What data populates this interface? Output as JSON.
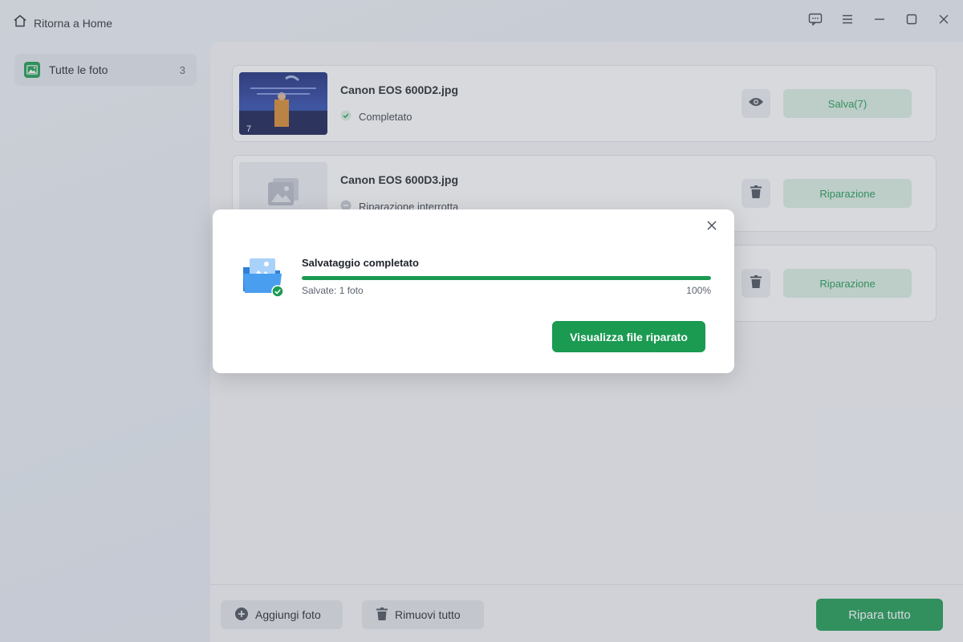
{
  "titlebar": {
    "home_label": "Ritorna a Home"
  },
  "sidebar": {
    "items": [
      {
        "label": "Tutte le foto",
        "count": "3"
      }
    ]
  },
  "files": [
    {
      "name": "Canon EOS 600D2.jpg",
      "status": "Completato",
      "status_icon": "check-circle-icon",
      "action_icon": "eye-icon",
      "action_label": "Salva(7)",
      "thumb_count": "7"
    },
    {
      "name": "Canon EOS 600D3.jpg",
      "status": "Riparazione interrotta",
      "status_icon": "minus-circle-icon",
      "action_icon": "trash-icon",
      "action_label": "Riparazione"
    },
    {
      "action_icon": "trash-icon",
      "action_label": "Riparazione"
    }
  ],
  "footer": {
    "add_label": "Aggiungi foto",
    "remove_label": "Rimuovi tutto",
    "repair_label": "Ripara tutto"
  },
  "dialog": {
    "title": "Salvataggio completato",
    "subtitle": "Salvate: 1 foto",
    "progress_label": "100%",
    "progress_value": 1.0,
    "button_label": "Visualizza file riparato"
  },
  "colors": {
    "accent": "#1b9a52",
    "accent_light": "#dcefe3",
    "background": "#f5f6f9"
  }
}
